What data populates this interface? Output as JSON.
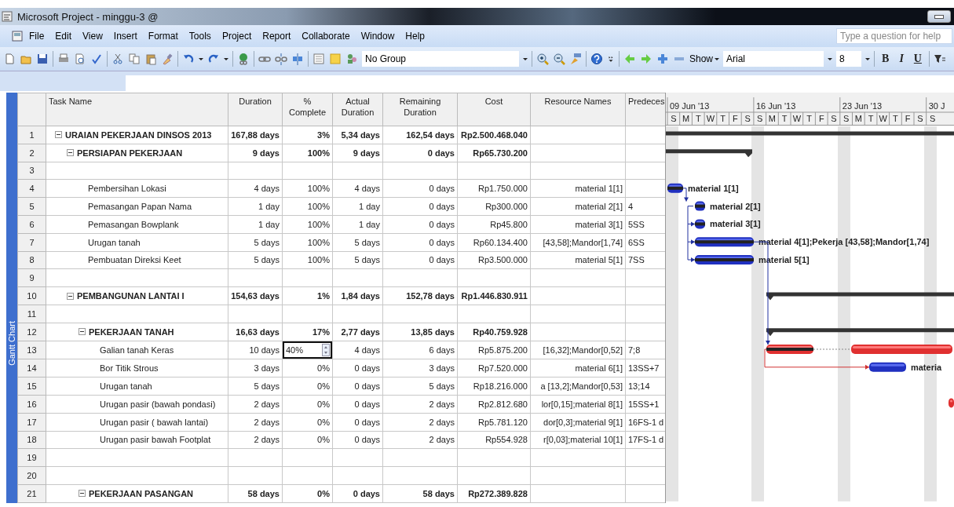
{
  "window": {
    "title": "Microsoft Project - minggu-3 @"
  },
  "menu": {
    "items": [
      "File",
      "Edit",
      "View",
      "Insert",
      "Format",
      "Tools",
      "Project",
      "Report",
      "Collaborate",
      "Window",
      "Help"
    ],
    "help_placeholder": "Type a question for help"
  },
  "toolbar": {
    "group_select": "No Group",
    "show_button": "Show",
    "font_select": "Arial",
    "size_select": "8",
    "format_buttons": [
      "B",
      "I",
      "U"
    ]
  },
  "view_bar": {
    "label": "Gantt Chart"
  },
  "table": {
    "columns": [
      "Task Name",
      "Duration",
      "% Complete",
      "Actual Duration",
      "Remaining Duration",
      "Cost",
      "Resource Names",
      "Predeces"
    ],
    "rows": [
      {
        "id": "1",
        "name": "URAIAN PEKERJAAN DINSOS 2013",
        "duration": "167,88 days",
        "complete": "3%",
        "actual": "5,34 days",
        "remaining": "162,54 days",
        "cost": "Rp2.500.468.040",
        "expanded": true,
        "selected": false,
        "children": [
          {
            "id": "2",
            "name": "PERSIAPAN PEKERJAAN",
            "duration": "9 days",
            "complete": "100%",
            "actual": "9 days",
            "remaining": "0 days",
            "cost": "Rp65.730.200",
            "expanded": true,
            "selected": false,
            "children": [
              {
                "id": "3",
                "selected": false
              },
              {
                "id": "4",
                "name": "Pembersihan Lokasi",
                "duration": "4 days",
                "complete": "100%",
                "actual": "4 days",
                "remaining": "0 days",
                "cost": "Rp1.750.000",
                "resources": "material 1[1]",
                "bar_label": "material 1[1]",
                "critical": false,
                "selected": false
              },
              {
                "id": "5",
                "name": "Pemasangan Papan Nama",
                "duration": "1 day",
                "complete": "100%",
                "actual": "1 day",
                "remaining": "0 days",
                "cost": "Rp300.000",
                "resources": "material 2[1]",
                "predecessors": "4",
                "bar_label": "material 2[1]",
                "critical": false,
                "selected": false
              },
              {
                "id": "6",
                "name": "Pemasangan Bowplank",
                "duration": "1 day",
                "complete": "100%",
                "actual": "1 day",
                "remaining": "0 days",
                "cost": "Rp45.800",
                "resources": "material 3[1]",
                "predecessors": "5SS",
                "bar_label": "material 3[1]",
                "critical": false,
                "selected": false
              },
              {
                "id": "7",
                "name": "Urugan tanah",
                "duration": "5 days",
                "complete": "100%",
                "actual": "5 days",
                "remaining": "0 days",
                "cost": "Rp60.134.400",
                "resources": "[43,58];Mandor[1,74]",
                "predecessors": "6SS",
                "bar_label": "material 4[1];Pekerja [43,58];Mandor[1,74]",
                "critical": false,
                "selected": false
              },
              {
                "id": "8",
                "name": "Pembuatan Direksi Keet",
                "duration": "5 days",
                "complete": "100%",
                "actual": "5 days",
                "remaining": "0 days",
                "cost": "Rp3.500.000",
                "resources": "material 5[1]",
                "predecessors": "7SS",
                "bar_label": "material 5[1]",
                "critical": false,
                "selected": false
              },
              {
                "id": "9",
                "selected": false
              }
            ]
          },
          {
            "id": "10",
            "name": "PEMBANGUNAN LANTAI I",
            "duration": "154,63 days",
            "complete": "1%",
            "actual": "1,84 days",
            "remaining": "152,78 days",
            "cost": "Rp1.446.830.911",
            "expanded": true,
            "selected": false,
            "children": [
              {
                "id": "11",
                "selected": false
              },
              {
                "id": "12",
                "name": "PEKERJAAN TANAH",
                "duration": "16,63 days",
                "complete": "17%",
                "actual": "2,77 days",
                "remaining": "13,85 days",
                "cost": "Rp40.759.928",
                "expanded": true,
                "selected": false,
                "children": [
                  {
                    "id": "13",
                    "name": "Galian tanah Keras",
                    "duration": "10 days",
                    "complete": "40%",
                    "actual": "4 days",
                    "remaining": "6 days",
                    "cost": "Rp5.875.200",
                    "resources": "[16,32];Mandor[0,52]",
                    "predecessors": "7;8",
                    "critical": true,
                    "selected": true
                  },
                  {
                    "id": "14",
                    "name": "Bor Titik Strous",
                    "duration": "3 days",
                    "complete": "0%",
                    "actual": "0 days",
                    "remaining": "3 days",
                    "cost": "Rp7.520.000",
                    "resources": "material 6[1]",
                    "predecessors": "13SS+7",
                    "bar_label": "materia",
                    "critical": false,
                    "selected": false
                  },
                  {
                    "id": "15",
                    "name": "Urugan tanah",
                    "duration": "5 days",
                    "complete": "0%",
                    "actual": "0 days",
                    "remaining": "5 days",
                    "cost": "Rp18.216.000",
                    "resources": "a [13,2];Mandor[0,53]",
                    "predecessors": "13;14",
                    "selected": false
                  },
                  {
                    "id": "16",
                    "name": "Urugan pasir (bawah pondasi)",
                    "duration": "2 days",
                    "complete": "0%",
                    "actual": "0 days",
                    "remaining": "2 days",
                    "cost": "Rp2.812.680",
                    "resources": "lor[0,15];material 8[1]",
                    "predecessors": "15SS+1",
                    "critical": true,
                    "selected": false
                  },
                  {
                    "id": "17",
                    "name": "Urugan pasir ( bawah lantai)",
                    "duration": "2 days",
                    "complete": "0%",
                    "actual": "0 days",
                    "remaining": "2 days",
                    "cost": "Rp5.781.120",
                    "resources": "dor[0,3];material 9[1]",
                    "predecessors": "16FS-1 d",
                    "selected": false
                  },
                  {
                    "id": "18",
                    "name": "Urugan pasir bawah Footplat",
                    "duration": "2 days",
                    "complete": "0%",
                    "actual": "0 days",
                    "remaining": "2 days",
                    "cost": "Rp554.928",
                    "resources": "r[0,03];material 10[1]",
                    "predecessors": "17FS-1 d",
                    "selected": false
                  },
                  {
                    "id": "19",
                    "selected": false
                  },
                  {
                    "id": "20",
                    "selected": false
                  }
                ]
              },
              {
                "id": "21",
                "name": "PEKERJAAN PASANGAN",
                "duration": "58 days",
                "complete": "0%",
                "actual": "0 days",
                "remaining": "58 days",
                "cost": "Rp272.389.828",
                "expanded": true,
                "selected": false
              }
            ]
          }
        ]
      }
    ]
  },
  "gantt": {
    "weeks": [
      "09 Jun '13",
      "16 Jun '13",
      "23 Jun '13",
      "30 J"
    ],
    "days": [
      "S",
      "M",
      "T",
      "W",
      "T",
      "F",
      "S",
      "S",
      "M",
      "T",
      "W",
      "T",
      "F",
      "S",
      "S",
      "M",
      "T",
      "W",
      "T",
      "F",
      "S",
      "S"
    ]
  }
}
